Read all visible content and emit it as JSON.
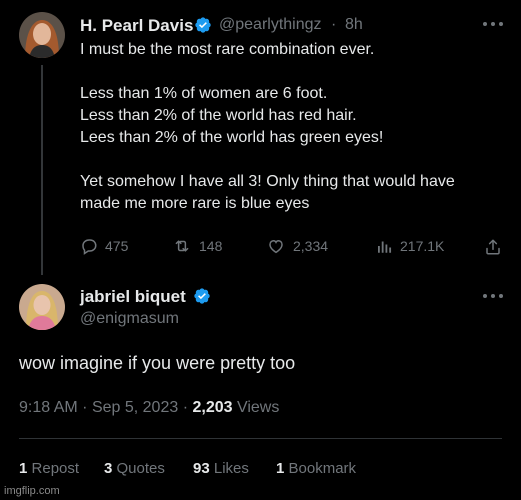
{
  "tweet": {
    "author_name": "H. Pearl Davis",
    "author_handle": "@pearlythingz",
    "separator": "·",
    "time": "8h",
    "lines": [
      "I must be the most rare combination ever.",
      "",
      "Less than 1% of women are 6 foot.",
      "Less than 2% of the world has red hair.",
      "Lees than 2% of the world has green eyes!",
      "",
      "Yet somehow I have all 3! Only thing that would have",
      "made me more rare is blue eyes"
    ],
    "actions": {
      "replies": "475",
      "reposts": "148",
      "likes": "2,334",
      "views": "217.1K"
    }
  },
  "reply": {
    "author_name": "jabriel biquet",
    "author_handle": "@enigmasum",
    "text": "wow imagine if you were pretty too",
    "time": "9:18 AM",
    "date": "Sep 5, 2023",
    "dot": "·",
    "views_count": "2,203",
    "views_label": "Views",
    "stats": {
      "reposts_count": "1",
      "reposts_label": "Repost",
      "quotes_count": "3",
      "quotes_label": "Quotes",
      "likes_count": "93",
      "likes_label": "Likes",
      "bookmarks_count": "1",
      "bookmarks_label": "Bookmark"
    }
  },
  "watermark": "imgflip.com",
  "colors": {
    "background": "#000000",
    "text": "#e7e9ea",
    "secondary": "#71767b",
    "verified": "#1d9bf0",
    "divider": "#2f3336"
  },
  "icons": [
    "more-icon",
    "verified-badge-icon",
    "reply-icon",
    "repost-icon",
    "like-icon",
    "views-icon",
    "share-icon"
  ]
}
